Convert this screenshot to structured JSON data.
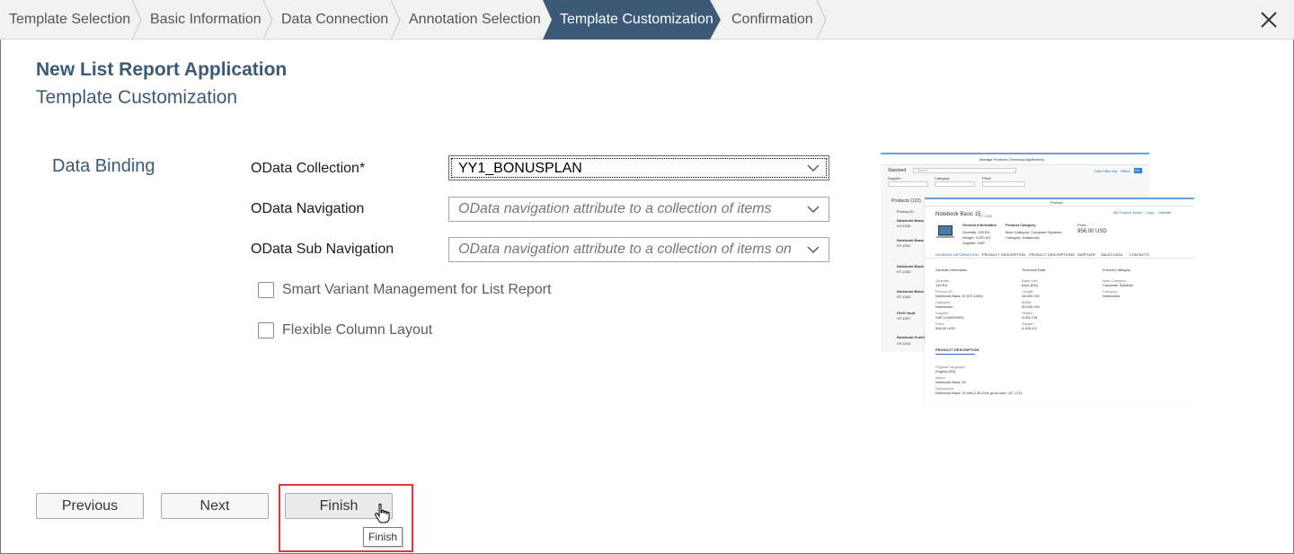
{
  "wizard": {
    "steps": [
      {
        "label": "Template Selection"
      },
      {
        "label": "Basic Information"
      },
      {
        "label": "Data Connection"
      },
      {
        "label": "Annotation Selection"
      },
      {
        "label": "Template Customization"
      },
      {
        "label": "Confirmation"
      }
    ],
    "active_step_index": 4,
    "colors": {
      "active_bg": "#3c5a78",
      "bar_bg": "#f2f2f2"
    }
  },
  "header": {
    "title": "New List Report Application",
    "subtitle": "Template Customization"
  },
  "section": {
    "label": "Data Binding"
  },
  "form": {
    "odata_collection": {
      "label": "OData Collection*",
      "value": "YY1_BONUSPLAN"
    },
    "odata_navigation": {
      "label": "OData Navigation",
      "placeholder": "OData navigation attribute to a collection of items"
    },
    "odata_sub_navigation": {
      "label": "OData Sub Navigation",
      "placeholder": "OData navigation attribute to a collection of items on su"
    },
    "smart_variant": {
      "label": "Smart Variant Management for List Report",
      "checked": false
    },
    "flexible_column": {
      "label": "Flexible Column Layout",
      "checked": false
    }
  },
  "preview": {
    "back": {
      "title": "Manage Products (Technical Application)",
      "standard": "Standard",
      "search_placeholder": "Search",
      "filters": [
        "Supplier:",
        "Category:",
        "Price:"
      ],
      "hide_filter_bar": "Hide Filter Bar",
      "filters_btn": "Filters",
      "go": "Go",
      "table_header": "Products (122)",
      "col": "Product ID",
      "rows": [
        "Notebook Basic 15",
        "HT-1000",
        "Notebook Basic 17",
        "HT-1001",
        "Notebook Basic 18",
        "HT-1002",
        "Notebook Basic 19",
        "HT-1003",
        "ITelO Vault",
        "HT-1007",
        "Notebook Professional",
        "HT-1010"
      ]
    },
    "front": {
      "title": "Product",
      "name": "Notebook Basic 15",
      "id": "HT-1000",
      "actions": [
        "My Custom Action",
        "Copy",
        "Validate"
      ],
      "general_information": "General Information",
      "product_category": "Product Category",
      "price_label": "Price:",
      "price": "956.00 USD",
      "quantity": "Quantity: 149 EA",
      "weight": "Weight: 4.200 KG",
      "supplier": "Supplier: SAP",
      "main_category": "Main Category: Computer Systems",
      "category": "Category: Notebooks",
      "tabs": [
        "GENERAL INFORMATION",
        "PRODUCT DESCRIPTION",
        "PRODUCT DESCRIPTIONS",
        "SUPPLIER",
        "SALES DATA",
        "CONTACTS"
      ],
      "columns": [
        "General Information",
        "Technical Data",
        "Product Category"
      ],
      "col1": [
        "Quantity:",
        "149 EA",
        "Product ID:",
        "Notebook Basic 15 (HT-1000)",
        "Category:",
        "Notebooks",
        "Supplier:",
        "SAP (100000000)",
        "Price:",
        "956.00 USD"
      ],
      "col2": [
        "Base Unit:",
        "each (EA)",
        "Length:",
        "18.000 CM",
        "Width:",
        "30.000 CM",
        "Height:",
        "3.000 CM",
        "Weight:",
        "4.200 KG"
      ],
      "col3": [
        "Main Category:",
        "Computer Systems",
        "Category:",
        "Notebooks"
      ],
      "description_header": "PRODUCT DESCRIPTION",
      "desc_lines": [
        "Original Language:",
        "English (EN)",
        "Name:",
        "Notebook Basic 15",
        "Description:",
        "Notebook Basic 15 with 2,80 GHz quad core, 15\" LCD,"
      ]
    }
  },
  "buttons": {
    "previous": "Previous",
    "next": "Next",
    "finish": "Finish"
  },
  "tooltip": "Finish"
}
